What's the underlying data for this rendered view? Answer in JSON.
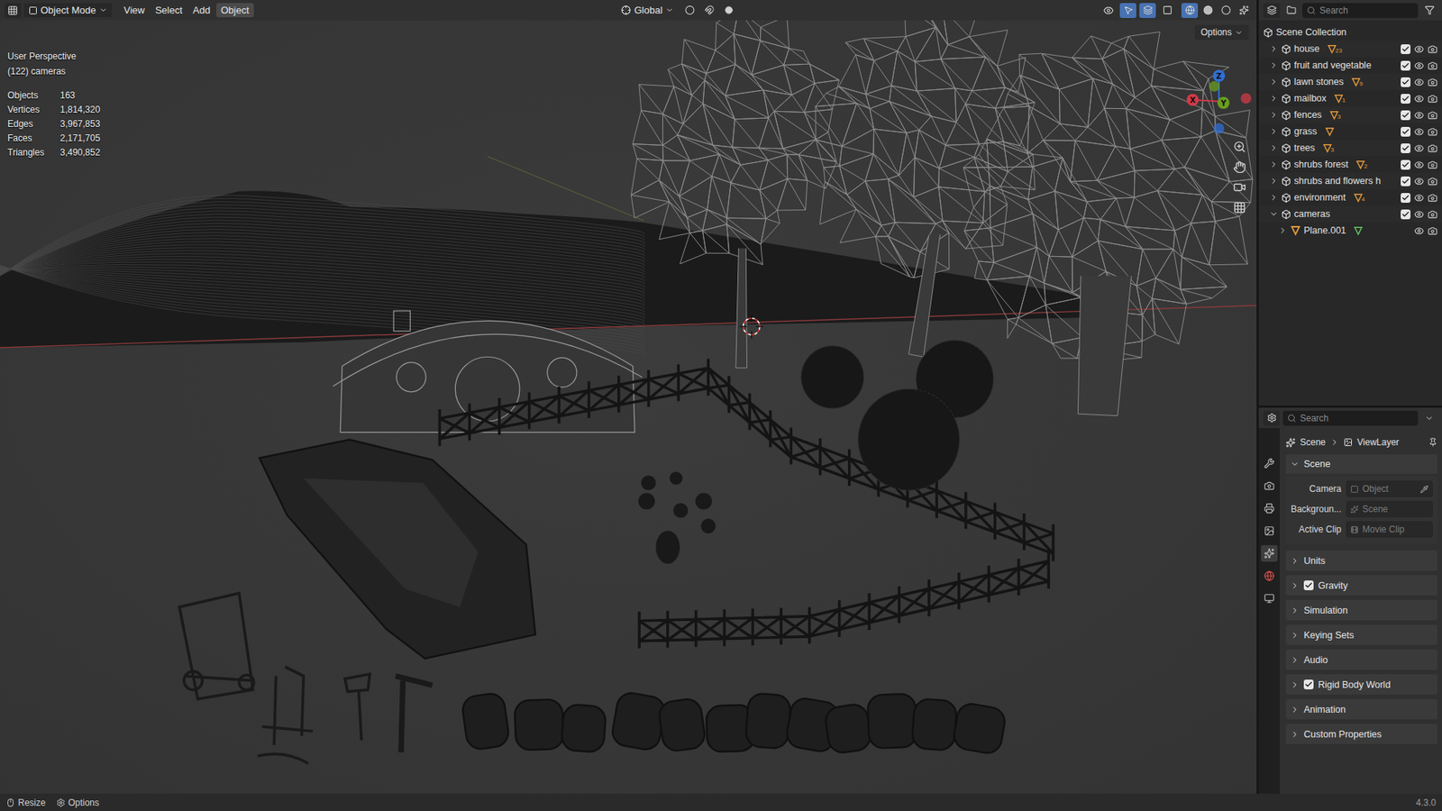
{
  "header": {
    "mode": "Object Mode",
    "menus": [
      {
        "label": "View",
        "selected": false
      },
      {
        "label": "Select",
        "selected": false
      },
      {
        "label": "Add",
        "selected": false
      },
      {
        "label": "Object",
        "selected": true
      }
    ],
    "orientation": "Global",
    "options": "Options"
  },
  "viewport": {
    "perspective": "User Perspective",
    "active_object": "(122) cameras",
    "stats": [
      {
        "label": "Objects",
        "value": "163"
      },
      {
        "label": "Vertices",
        "value": "1,814,320"
      },
      {
        "label": "Edges",
        "value": "3,967,853"
      },
      {
        "label": "Faces",
        "value": "2,171,705"
      },
      {
        "label": "Triangles",
        "value": "3,490,852"
      }
    ],
    "gizmo": [
      {
        "axis": "Z",
        "color": "#2f6fd6"
      },
      {
        "axis": "X",
        "color": "#d23a48"
      },
      {
        "axis": "Y",
        "color": "#6a9e1f"
      }
    ]
  },
  "outliner": {
    "search": "Search",
    "root": "Scene Collection",
    "items": [
      {
        "name": "house",
        "kind": "collection",
        "expanded": false,
        "mesh": true,
        "count": "23",
        "checked": true
      },
      {
        "name": "fruit and vegetable",
        "kind": "collection",
        "expanded": false,
        "mesh": false,
        "count": "",
        "checked": true
      },
      {
        "name": "lawn stones",
        "kind": "collection",
        "expanded": false,
        "mesh": true,
        "count": "9",
        "checked": true
      },
      {
        "name": "mailbox",
        "kind": "collection",
        "expanded": false,
        "mesh": true,
        "count": "1",
        "checked": true
      },
      {
        "name": "fences",
        "kind": "collection",
        "expanded": false,
        "mesh": true,
        "count": "3",
        "checked": true
      },
      {
        "name": "grass",
        "kind": "collection",
        "expanded": false,
        "mesh": true,
        "count": "",
        "checked": true
      },
      {
        "name": "trees",
        "kind": "collection",
        "expanded": false,
        "mesh": true,
        "count": "3",
        "checked": true
      },
      {
        "name": "shrubs forest",
        "kind": "collection",
        "expanded": false,
        "mesh": true,
        "count": "2",
        "checked": true
      },
      {
        "name": "shrubs and flowers h",
        "kind": "collection",
        "expanded": false,
        "mesh": false,
        "count": "",
        "checked": true
      },
      {
        "name": "environment",
        "kind": "collection",
        "expanded": false,
        "mesh": true,
        "count": "4",
        "checked": true
      },
      {
        "name": "cameras",
        "kind": "collection",
        "expanded": true,
        "mesh": false,
        "count": "",
        "checked": true
      },
      {
        "name": "Plane.001",
        "kind": "object",
        "expanded": false,
        "mesh": true,
        "count": "",
        "checked": false
      }
    ]
  },
  "properties": {
    "search": "Search",
    "breadcrumb": [
      "Scene",
      "ViewLayer"
    ],
    "panel": {
      "title": "Scene",
      "expanded": true,
      "fields": [
        {
          "label": "Camera",
          "value": "Object"
        },
        {
          "label": "Backgroun...",
          "value": "Scene"
        },
        {
          "label": "Active Clip",
          "value": "Movie Clip"
        }
      ]
    },
    "subpanels": [
      {
        "label": "Units",
        "kind": "plain"
      },
      {
        "label": "Gravity",
        "kind": "toggle",
        "checked": true
      },
      {
        "label": "Simulation",
        "kind": "plain"
      },
      {
        "label": "Keying Sets",
        "kind": "plain"
      },
      {
        "label": "Audio",
        "kind": "plain"
      },
      {
        "label": "Rigid Body World",
        "kind": "toggle",
        "checked": true
      },
      {
        "label": "Animation",
        "kind": "plain"
      },
      {
        "label": "Custom Properties",
        "kind": "plain"
      }
    ]
  },
  "status_bar": {
    "items": [
      "Resize",
      "Options"
    ],
    "version": "4.3.0"
  }
}
